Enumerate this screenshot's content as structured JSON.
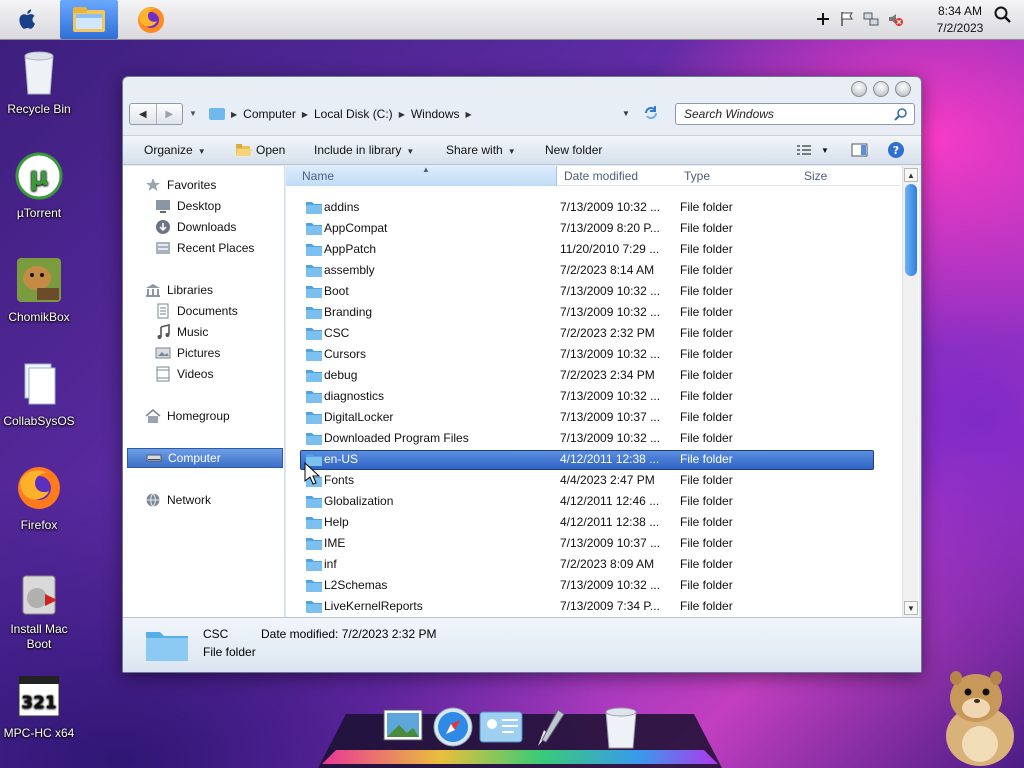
{
  "menubar": {
    "clock_time": "8:34 AM",
    "clock_date": "7/2/2023",
    "apple_icon": "apple-logo-icon",
    "pinned": [
      "file-explorer-icon",
      "firefox-icon"
    ],
    "tray_icons": [
      "plus-icon",
      "flag-icon",
      "network-icon",
      "volume-muted-icon"
    ]
  },
  "desktop": {
    "icons": [
      {
        "label": "Recycle Bin",
        "icon": "recycle-bin-icon"
      },
      {
        "label": "µTorrent",
        "icon": "utorrent-icon"
      },
      {
        "label": "ChomikBox",
        "icon": "chomikbox-icon"
      },
      {
        "label": "CollabSysOS",
        "icon": "document-icon"
      },
      {
        "label": "Firefox",
        "icon": "firefox-icon"
      },
      {
        "label": "Install Mac Boot",
        "icon": "installer-icon"
      },
      {
        "label": "MPC-HC x64",
        "icon": "mpc-hc-icon"
      }
    ]
  },
  "window": {
    "breadcrumb": [
      "Computer",
      "Local Disk (C:)",
      "Windows"
    ],
    "search_placeholder": "Search Windows",
    "toolbar": {
      "organize": "Organize",
      "open": "Open",
      "include": "Include in library",
      "share": "Share with",
      "new_folder": "New folder"
    },
    "nav": {
      "favorites": "Favorites",
      "desktop": "Desktop",
      "downloads": "Downloads",
      "recent": "Recent Places",
      "libraries": "Libraries",
      "documents": "Documents",
      "music": "Music",
      "pictures": "Pictures",
      "videos": "Videos",
      "homegroup": "Homegroup",
      "computer": "Computer",
      "network": "Network"
    },
    "columns": {
      "name": "Name",
      "date": "Date modified",
      "type": "Type",
      "size": "Size"
    },
    "files": [
      {
        "name": "addins",
        "date": "7/13/2009 10:32 ...",
        "type": "File folder"
      },
      {
        "name": "AppCompat",
        "date": "7/13/2009 8:20 P...",
        "type": "File folder"
      },
      {
        "name": "AppPatch",
        "date": "11/20/2010 7:29 ...",
        "type": "File folder"
      },
      {
        "name": "assembly",
        "date": "7/2/2023 8:14 AM",
        "type": "File folder"
      },
      {
        "name": "Boot",
        "date": "7/13/2009 10:32 ...",
        "type": "File folder"
      },
      {
        "name": "Branding",
        "date": "7/13/2009 10:32 ...",
        "type": "File folder"
      },
      {
        "name": "CSC",
        "date": "7/2/2023 2:32 PM",
        "type": "File folder"
      },
      {
        "name": "Cursors",
        "date": "7/13/2009 10:32 ...",
        "type": "File folder"
      },
      {
        "name": "debug",
        "date": "7/2/2023 2:34 PM",
        "type": "File folder"
      },
      {
        "name": "diagnostics",
        "date": "7/13/2009 10:32 ...",
        "type": "File folder"
      },
      {
        "name": "DigitalLocker",
        "date": "7/13/2009 10:37 ...",
        "type": "File folder"
      },
      {
        "name": "Downloaded Program Files",
        "date": "7/13/2009 10:32 ...",
        "type": "File folder"
      },
      {
        "name": "en-US",
        "date": "4/12/2011 12:38 ...",
        "type": "File folder",
        "selected": true
      },
      {
        "name": "Fonts",
        "date": "4/4/2023 2:47 PM",
        "type": "File folder"
      },
      {
        "name": "Globalization",
        "date": "4/12/2011 12:46 ...",
        "type": "File folder"
      },
      {
        "name": "Help",
        "date": "4/12/2011 12:38 ...",
        "type": "File folder"
      },
      {
        "name": "IME",
        "date": "7/13/2009 10:37 ...",
        "type": "File folder"
      },
      {
        "name": "inf",
        "date": "7/2/2023 8:09 AM",
        "type": "File folder"
      },
      {
        "name": "L2Schemas",
        "date": "7/13/2009 10:32 ...",
        "type": "File folder"
      },
      {
        "name": "LiveKernelReports",
        "date": "7/13/2009 7:34 P...",
        "type": "File folder"
      }
    ],
    "details": {
      "name": "CSC",
      "type": "File folder",
      "date_label": "Date modified:",
      "date_value": "7/2/2023 2:32 PM"
    }
  },
  "dock": {
    "items": [
      "image-viewer-icon",
      "safari-icon",
      "contacts-icon",
      "pen-tool-icon",
      "trash-icon"
    ]
  },
  "colors": {
    "selection": "#3d70c8",
    "header_sorted": "#c1dcf7",
    "folder": "#6fb8ee"
  }
}
